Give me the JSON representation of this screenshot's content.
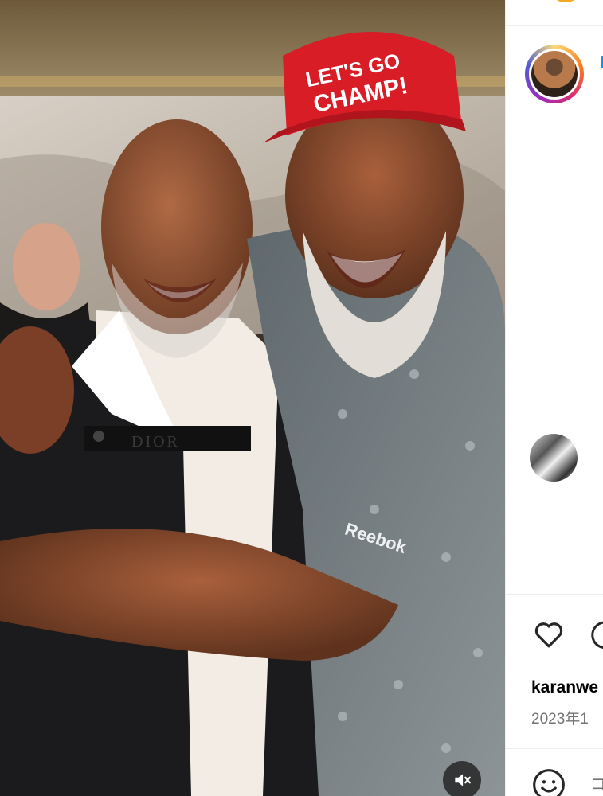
{
  "post": {
    "image_alt": "Two men smiling and hugging at an event",
    "cap_text_line1": "LET'S GO",
    "cap_text_line2": "CHAMP!",
    "shirt_brand": "Reebok",
    "strap_text": "DIOR"
  },
  "panel": {
    "likes_user": "karanwe",
    "date": "2023年1",
    "comment_placeholder": "コ"
  },
  "icons": {
    "mute": "volume-muted-icon",
    "like": "heart-icon",
    "comment": "comment-icon",
    "emoji": "emoji-icon"
  },
  "colors": {
    "cap_red": "#d81d27",
    "shirt_gray": "#7d8588",
    "jacket_black": "#1b1b1d",
    "link_blue": "#0095f6"
  }
}
